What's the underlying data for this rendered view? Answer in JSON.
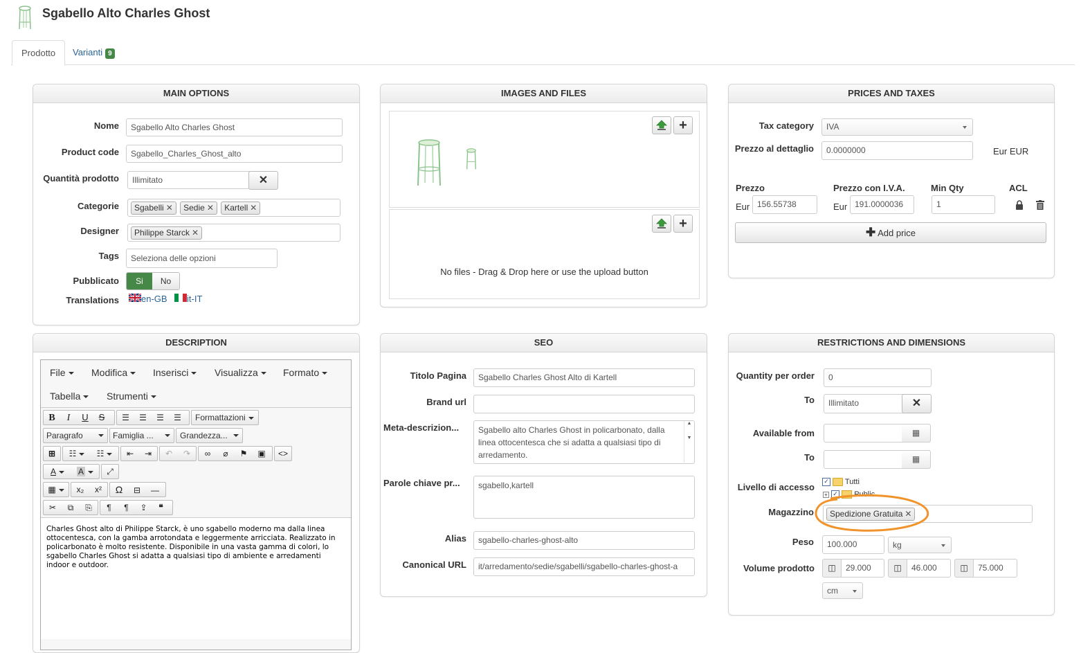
{
  "header": {
    "title": "Sgabello Alto Charles Ghost"
  },
  "tabs": {
    "prodotto": "Prodotto",
    "varianti": "Varianti",
    "varianti_count": "9"
  },
  "main_options": {
    "heading": "MAIN OPTIONS",
    "nome_label": "Nome",
    "nome_value": "Sgabello Alto Charles Ghost",
    "code_label": "Product code",
    "code_value": "Sgabello_Charles_Ghost_alto",
    "qty_label": "Quantità prodotto",
    "qty_value": "Illimitato",
    "cat_label": "Categorie",
    "categories": [
      "Sgabelli",
      "Sedie",
      "Kartell"
    ],
    "designer_label": "Designer",
    "designer": "Philippe Starck",
    "tags_label": "Tags",
    "tags_placeholder": "Seleziona delle opzioni",
    "pub_label": "Pubblicato",
    "pub_yes": "Si",
    "pub_no": "No",
    "trans_label": "Translations",
    "trans_en": "en-GB",
    "trans_it": "it-IT"
  },
  "images": {
    "heading": "IMAGES AND FILES",
    "no_files": "No files - Drag & Drop here or use the upload button"
  },
  "prices": {
    "heading": "PRICES AND TAXES",
    "tax_label": "Tax category",
    "tax_value": "IVA",
    "retail_label": "Prezzo al dettaglio",
    "retail_value": "0.0000000",
    "retail_currency": "Eur EUR",
    "col_prezzo": "Prezzo",
    "col_iva": "Prezzo con I.V.A.",
    "col_minqty": "Min Qty",
    "col_acl": "ACL",
    "eur1": "Eur",
    "prezzo": "156.55738",
    "eur2": "Eur",
    "prezzo_iva": "191.0000036",
    "min_qty": "1",
    "add_price": "Add price"
  },
  "description": {
    "heading": "DESCRIPTION",
    "menus": [
      "File",
      "Modifica",
      "Inserisci",
      "Visualizza",
      "Formato"
    ],
    "menus2": [
      "Tabella",
      "Strumenti"
    ],
    "formats": "Formattazioni",
    "para": "Paragrafo",
    "family": "Famiglia ...",
    "size": "Grandezza...",
    "body": "Charles Ghost alto di Philippe Starck, è uno sgabello moderno ma dalla linea ottocentesca, con la gamba arrotondata e leggermente arricciata. Realizzato in policarbonato è molto resistente. Disponibile in una vasta gamma di colori, lo sgabello Charles Ghost si adatta a qualsiasi tipo di ambiente e arredamenti indoor e outdoor."
  },
  "seo": {
    "heading": "SEO",
    "titolo_label": "Titolo Pagina",
    "titolo_value": "Sgabello Charles Ghost Alto di Kartell",
    "brand_label": "Brand url",
    "brand_value": "",
    "meta_label": "Meta-descrizion...",
    "meta_value": "Sgabello alto Charles Ghost in policarbonato, dalla linea ottocentesca che si adatta a qualsiasi tipo di arredamento.",
    "keys_label": "Parole chiave pr...",
    "keys_value": "sgabello,kartell",
    "alias_label": "Alias",
    "alias_value": "sgabello-charles-ghost-alto",
    "canon_label": "Canonical URL",
    "canon_value": "it/arredamento/sedie/sgabelli/sgabello-charles-ghost-a"
  },
  "restrictions": {
    "heading": "RESTRICTIONS AND DIMENSIONS",
    "qpo_label": "Quantity per order",
    "qpo_value": "0",
    "to_label": "To",
    "to_value": "Illimitato",
    "avail_label": "Available from",
    "to2_label": "To",
    "access_label": "Livello di accesso",
    "access_tutti": "Tutti",
    "access_public": "Public",
    "mag_label": "Magazzino",
    "mag_tag": "Spedizione Gratuita",
    "peso_label": "Peso",
    "peso_value": "100.000",
    "peso_unit": "kg",
    "vol_label": "Volume prodotto",
    "vol_1": "29.000",
    "vol_2": "46.000",
    "vol_3": "75.000",
    "vol_unit": "cm"
  },
  "colors": {
    "accent_green": "#468847",
    "link_blue": "#2a6496",
    "highlight_orange": "#f0932b"
  }
}
